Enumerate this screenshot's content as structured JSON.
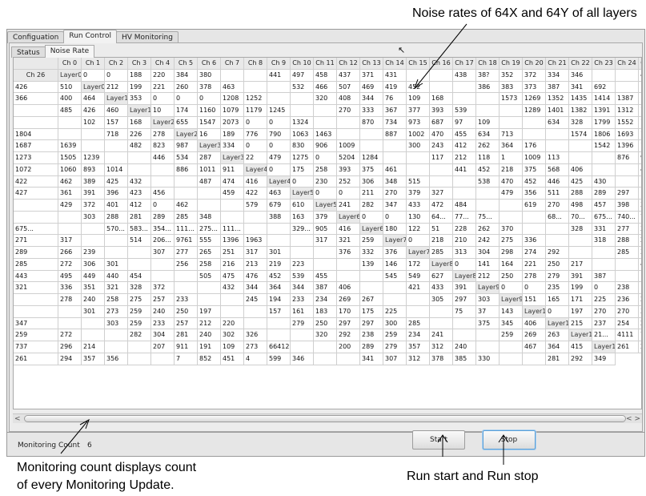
{
  "annotations": {
    "noise_rates": "Noise rates of 64X and 64Y of all layers",
    "monitoring_count_line1": "Monitoring count displays count",
    "monitoring_count_line2": "of every Monitoring Update.",
    "run_start_stop": "Run start and Run stop"
  },
  "tabs": [
    {
      "label": "Configuation",
      "active": false
    },
    {
      "label": "Run Control",
      "active": true
    },
    {
      "label": "HV Monitoring",
      "active": false
    }
  ],
  "subtabs": [
    {
      "label": "Status",
      "active": false
    },
    {
      "label": "Noise Rate",
      "active": true
    }
  ],
  "table": {
    "columns": [
      "Ch 0",
      "Ch 1",
      "Ch 2",
      "Ch 3",
      "Ch 4",
      "Ch 5",
      "Ch 6",
      "Ch 7",
      "Ch 8",
      "Ch 9",
      "Ch 10",
      "Ch 11",
      "Ch 12",
      "Ch 13",
      "Ch 14",
      "Ch 15",
      "Ch 16",
      "Ch 17",
      "Ch 18",
      "Ch 19",
      "Ch 20",
      "Ch 21",
      "Ch 22",
      "Ch 23",
      "Ch 24",
      "Ch 25",
      "Ch 26"
    ],
    "rows": [
      {
        "label": "Layer0 X",
        "cells": [
          "0",
          "0",
          "188",
          "220",
          "384",
          "380",
          "",
          "",
          "441",
          "497",
          "458",
          "437",
          "371",
          "431",
          "",
          "",
          "438",
          "38?",
          "352",
          "372",
          "334",
          "346",
          "",
          "",
          "433",
          "426",
          "510"
        ]
      },
      {
        "label": "Layer0 Y",
        "cells": [
          "212",
          "199",
          "221",
          "260",
          "378",
          "463",
          "",
          "",
          "532",
          "466",
          "507",
          "469",
          "419",
          "452",
          "",
          "",
          "386",
          "383",
          "373",
          "387",
          "341",
          "692",
          "",
          "",
          "366",
          "400",
          "464"
        ]
      },
      {
        "label": "Layer1 X",
        "cells": [
          "353",
          "0",
          "0",
          "0",
          "1208",
          "1252",
          "",
          "",
          "320",
          "408",
          "344",
          "76",
          "109",
          "168",
          "",
          "",
          "1573",
          "1269",
          "1352",
          "1435",
          "1414",
          "1387",
          "",
          "",
          "485",
          "426",
          "460"
        ]
      },
      {
        "label": "Layer1 Y",
        "cells": [
          "10",
          "174",
          "1160",
          "1079",
          "1179",
          "1245",
          "",
          "",
          "270",
          "333",
          "367",
          "377",
          "393",
          "539",
          "",
          "",
          "1289",
          "1401",
          "1382",
          "1391",
          "1312",
          "1314",
          "",
          "",
          "102",
          "157",
          "168"
        ]
      },
      {
        "label": "Layer2 X",
        "cells": [
          "655",
          "1547",
          "2073",
          "0",
          "0",
          "1324",
          "",
          "",
          "870",
          "734",
          "973",
          "687",
          "97",
          "109",
          "",
          "",
          "634",
          "328",
          "1799",
          "1552",
          "1641",
          "1804",
          "",
          "",
          "718",
          "226",
          "278"
        ]
      },
      {
        "label": "Layer2 Y",
        "cells": [
          "16",
          "189",
          "776",
          "790",
          "1063",
          "1463",
          "",
          "",
          "887",
          "1002",
          "470",
          "455",
          "634",
          "713",
          "",
          "",
          "1574",
          "1806",
          "1693",
          "1893",
          "1687",
          "1639",
          "",
          "",
          "482",
          "823",
          "987"
        ]
      },
      {
        "label": "Layer3 X",
        "cells": [
          "334",
          "0",
          "0",
          "830",
          "906",
          "1009",
          "",
          "",
          "300",
          "243",
          "412",
          "262",
          "364",
          "176",
          "",
          "",
          "1542",
          "1396",
          "1437",
          "1273",
          "1505",
          "1239",
          "",
          "",
          "446",
          "534",
          "287"
        ]
      },
      {
        "label": "Layer3 Y",
        "cells": [
          "22",
          "479",
          "1275",
          "0",
          "5204",
          "1284",
          "",
          "",
          "117",
          "212",
          "118",
          "1",
          "1009",
          "113",
          "",
          "",
          "876",
          "979",
          "1072",
          "1060",
          "893",
          "1014",
          "",
          "",
          "886",
          "1011",
          "911"
        ]
      },
      {
        "label": "Layer4 X",
        "cells": [
          "0",
          "175",
          "258",
          "393",
          "375",
          "461",
          "",
          "",
          "441",
          "452",
          "218",
          "375",
          "568",
          "406",
          "",
          "",
          "455",
          "422",
          "462",
          "389",
          "425",
          "432",
          "",
          "",
          "487",
          "474",
          "416"
        ]
      },
      {
        "label": "Layer4 Y",
        "cells": [
          "0",
          "230",
          "252",
          "306",
          "348",
          "515",
          "",
          "",
          "538",
          "470",
          "452",
          "446",
          "425",
          "430",
          "",
          "",
          "427",
          "361",
          "391",
          "396",
          "423",
          "456",
          "",
          "",
          "459",
          "422",
          "463"
        ]
      },
      {
        "label": "Layer5 X",
        "cells": [
          "0",
          "0",
          "211",
          "270",
          "379",
          "327",
          "",
          "",
          "479",
          "356",
          "511",
          "288",
          "289",
          "297",
          "",
          "",
          "429",
          "372",
          "401",
          "412",
          "0",
          "462",
          "",
          "",
          "579",
          "679",
          "610"
        ]
      },
      {
        "label": "Layer5 Y",
        "cells": [
          "241",
          "282",
          "347",
          "433",
          "472",
          "484",
          "",
          "",
          "619",
          "270",
          "498",
          "457",
          "398",
          "330",
          "",
          "",
          "303",
          "288",
          "281",
          "289",
          "285",
          "348",
          "",
          "",
          "388",
          "163",
          "379"
        ]
      },
      {
        "label": "Layer6 X",
        "cells": [
          "0",
          "0",
          "130",
          "64...",
          "77...",
          "75...",
          "",
          "",
          "68...",
          "70...",
          "675...",
          "740...",
          "753...",
          "675...",
          "",
          "",
          "570...",
          "583...",
          "354...",
          "111...",
          "275...",
          "111...",
          "",
          "",
          "329...",
          "905",
          "416"
        ]
      },
      {
        "label": "Layer6 Y",
        "cells": [
          "180",
          "122",
          "51",
          "228",
          "262",
          "370",
          "",
          "",
          "328",
          "331",
          "277",
          "369",
          "271",
          "317",
          "",
          "",
          "514",
          "206...",
          "9761",
          "555",
          "1396",
          "1963",
          "",
          "",
          "317",
          "321",
          "259"
        ]
      },
      {
        "label": "Layer7 X",
        "cells": [
          "0",
          "218",
          "210",
          "242",
          "275",
          "336",
          "",
          "",
          "318",
          "288",
          "272",
          "289",
          "266",
          "239",
          "",
          "",
          "307",
          "277",
          "265",
          "251",
          "317",
          "301",
          "",
          "",
          "376",
          "332",
          "376"
        ]
      },
      {
        "label": "Layer7 Y",
        "cells": [
          "285",
          "313",
          "304",
          "298",
          "274",
          "292",
          "",
          "",
          "285",
          "309",
          "285",
          "272",
          "306",
          "301",
          "",
          "",
          "256",
          "258",
          "216",
          "213",
          "219",
          "223",
          "",
          "",
          "139",
          "146",
          "172"
        ]
      },
      {
        "label": "Layer8 X",
        "cells": [
          "0",
          "141",
          "164",
          "221",
          "250",
          "217",
          "",
          "",
          "428",
          "443",
          "495",
          "449",
          "440",
          "454",
          "",
          "",
          "505",
          "475",
          "476",
          "452",
          "539",
          "455",
          "",
          "",
          "545",
          "549",
          "627"
        ]
      },
      {
        "label": "Layer8 Y",
        "cells": [
          "212",
          "250",
          "278",
          "279",
          "391",
          "387",
          "",
          "",
          "321",
          "336",
          "351",
          "321",
          "328",
          "372",
          "",
          "",
          "432",
          "344",
          "364",
          "344",
          "387",
          "406",
          "",
          "",
          "421",
          "433",
          "391"
        ]
      },
      {
        "label": "Layer9 X",
        "cells": [
          "0",
          "0",
          "235",
          "199",
          "0",
          "238",
          "",
          "",
          "278",
          "240",
          "258",
          "275",
          "257",
          "233",
          "",
          "",
          "245",
          "194",
          "233",
          "234",
          "269",
          "267",
          "",
          "",
          "305",
          "297",
          "303"
        ]
      },
      {
        "label": "Layer9 Y",
        "cells": [
          "151",
          "165",
          "171",
          "225",
          "236",
          "283",
          "",
          "",
          "301",
          "273",
          "259",
          "240",
          "250",
          "197",
          "",
          "",
          "157",
          "161",
          "183",
          "170",
          "175",
          "225",
          "",
          "",
          "75",
          "37",
          "143"
        ]
      },
      {
        "label": "Layer10 X",
        "cells": [
          "0",
          "197",
          "270",
          "270",
          "342",
          "347",
          "",
          "",
          "303",
          "259",
          "233",
          "257",
          "212",
          "220",
          "",
          "",
          "279",
          "250",
          "297",
          "297",
          "300",
          "285",
          "",
          "",
          "375",
          "345",
          "406"
        ]
      },
      {
        "label": "Layer10 Y",
        "cells": [
          "215",
          "237",
          "254",
          "269",
          "259",
          "272",
          "",
          "",
          "282",
          "304",
          "281",
          "240",
          "302",
          "326",
          "",
          "",
          "320",
          "292",
          "238",
          "259",
          "234",
          "241",
          "",
          "",
          "259",
          "269",
          "263"
        ]
      },
      {
        "label": "Layer11 X",
        "cells": [
          "21...",
          "4111",
          "77...",
          "737",
          "296",
          "214",
          "",
          "",
          "207",
          "911",
          "191",
          "109",
          "273",
          "66412",
          "",
          "",
          "200",
          "289",
          "279",
          "357",
          "312",
          "240",
          "",
          "",
          "467",
          "364",
          "415"
        ]
      },
      {
        "label": "Layer11 Y",
        "cells": [
          "261",
          "245",
          "261",
          "294",
          "357",
          "356",
          "",
          "",
          "7",
          "852",
          "451",
          "4",
          "599",
          "346",
          "",
          "",
          "341",
          "307",
          "312",
          "378",
          "385",
          "330",
          "",
          "",
          "281",
          "292",
          "349"
        ]
      }
    ]
  },
  "scroll": {
    "left_arrow": "<",
    "right_arrow": "< >"
  },
  "monitoring": {
    "label": "Monitoring Count",
    "value": "6"
  },
  "buttons": {
    "start": "Start",
    "stop": "Stop"
  },
  "icons": {
    "cursor": "mouse-pointer-icon"
  }
}
